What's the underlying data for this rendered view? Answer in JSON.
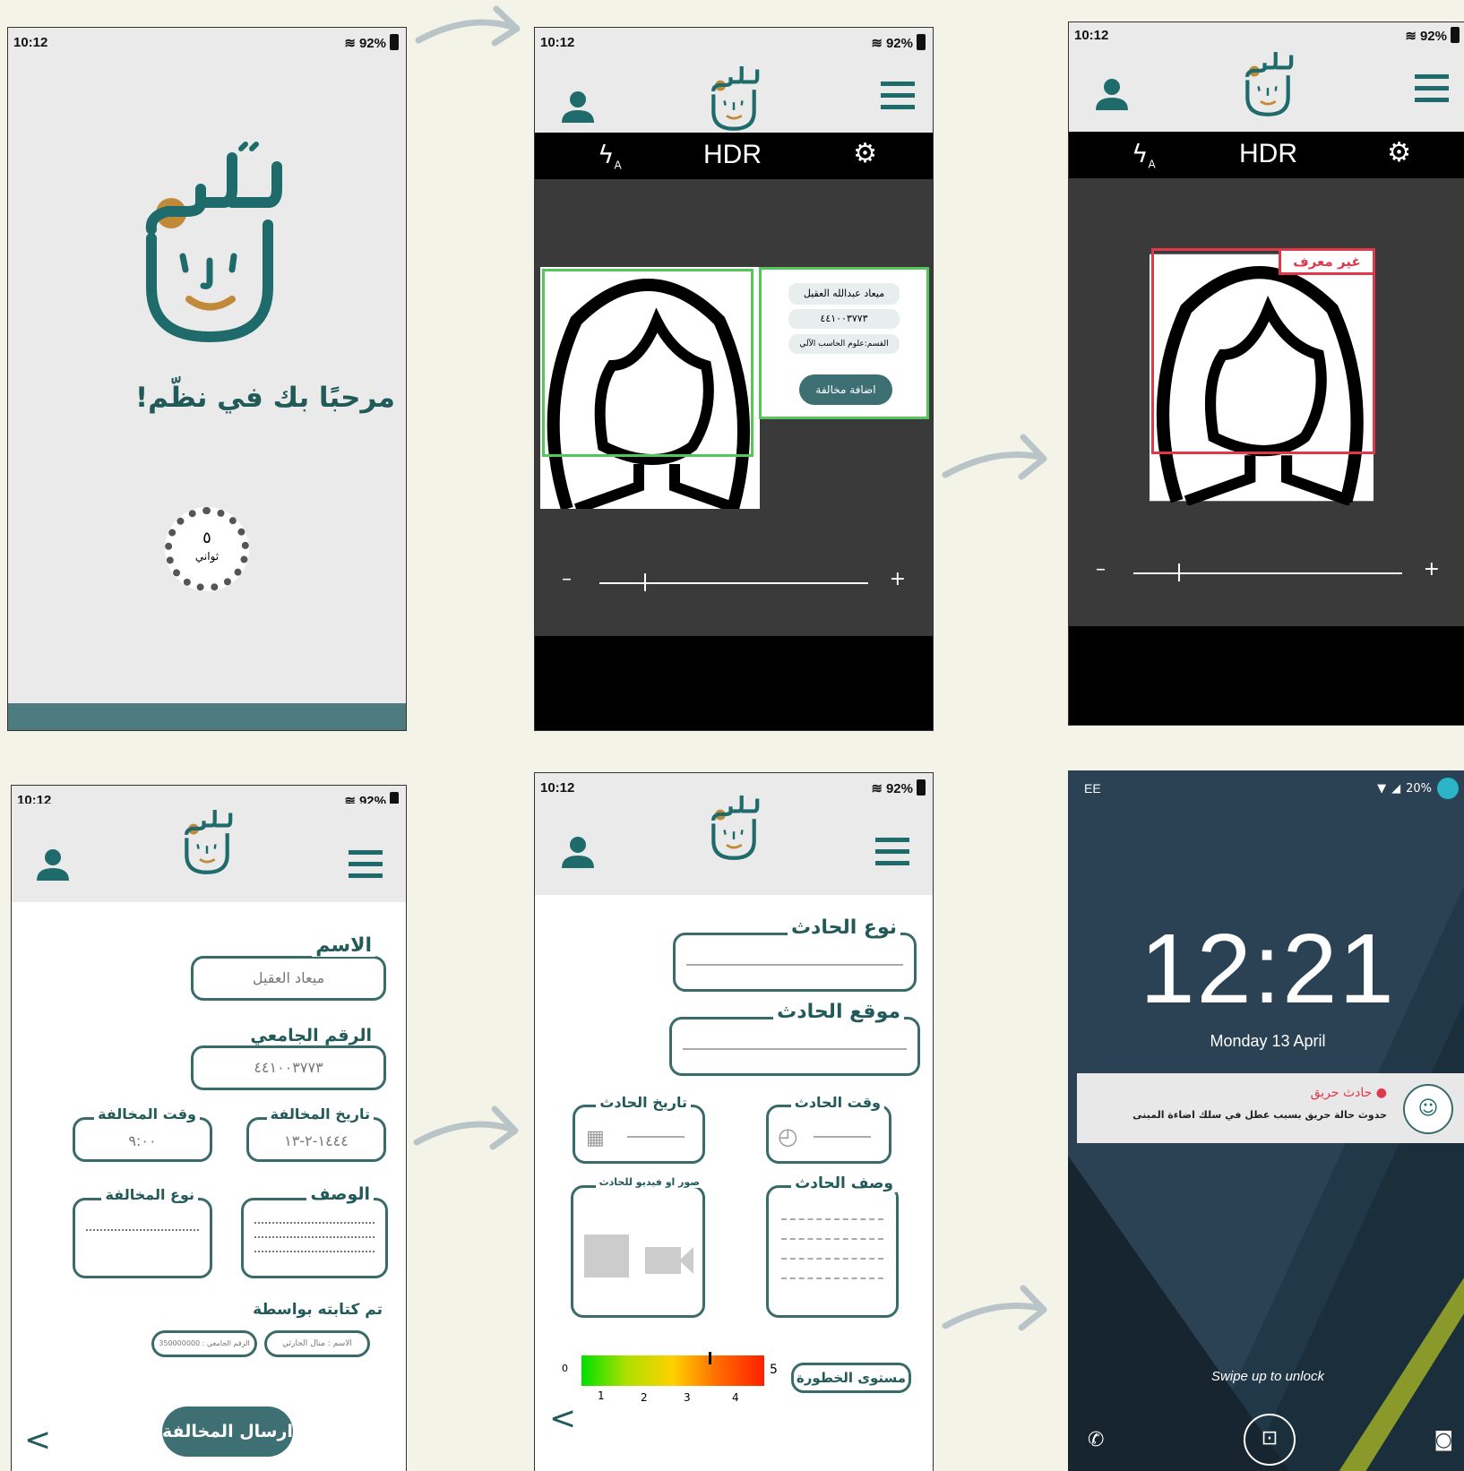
{
  "status": {
    "time": "10:12",
    "battery": "92%"
  },
  "splash": {
    "welcome": "مرحبًا بك في نظّم!",
    "countdown_number": "٥",
    "countdown_unit": "ثواني"
  },
  "camera": {
    "hdr": "HDR",
    "flash_label": "A",
    "zoom_minus": "–",
    "zoom_plus": "+",
    "recognized": {
      "name": "ميعاد عبدالله العقيل",
      "id": "٤٤١٠٠٣٧٧٣",
      "department": "القسم:علوم الحاسب الآلي",
      "add_violation": "اضافة مخالفة"
    },
    "unknown_label": "غير معرف"
  },
  "violation_form": {
    "name_label": "الاسم",
    "name_value": "ميعاد العقيل",
    "id_label": "الرقم الجامعي",
    "id_value": "٤٤١٠٠٣٧٧٣",
    "date_label": "تاريخ المخالفة",
    "date_value": "١٤٤٤-٢-١٣",
    "time_label": "وقت المخالفة",
    "time_value": "٩:٠٠",
    "desc_label": "الوصف",
    "type_label": "نوع المخالفة",
    "written_by": "تم كتابته بواسطة",
    "writer_name": "الاسم : منال الحارثي",
    "writer_id": "الرقم الجامعي : 350000000",
    "submit": "ارسال المخالفة",
    "back": "<"
  },
  "incident_form": {
    "type_label": "نوع الحادث",
    "location_label": "موقع الحادث",
    "date_label": "تاريخ الحادث",
    "time_label": "وقت الحادث",
    "media_label": "صور او فيديو للحادث",
    "desc_label": "وصف الحادث",
    "severity_label": "مستوى الخطورة",
    "scale_min": "0",
    "scale_max": "5",
    "ticks": [
      "1",
      "2",
      "3",
      "4"
    ],
    "back": "<"
  },
  "lockscreen": {
    "carrier": "EE",
    "battery": "20%",
    "time": "12:21",
    "date": "Monday 13 April",
    "notif_title": "حادث حريق",
    "notif_body": "حدوث حالة حريق بسبب عطل في سلك اضاءة المبنى",
    "swipe": "Swipe up to unlock"
  },
  "colors": {
    "teal": "#1f6b6b",
    "accent": "#c08a3a",
    "green": "#55c75a",
    "red": "#e0384b"
  }
}
